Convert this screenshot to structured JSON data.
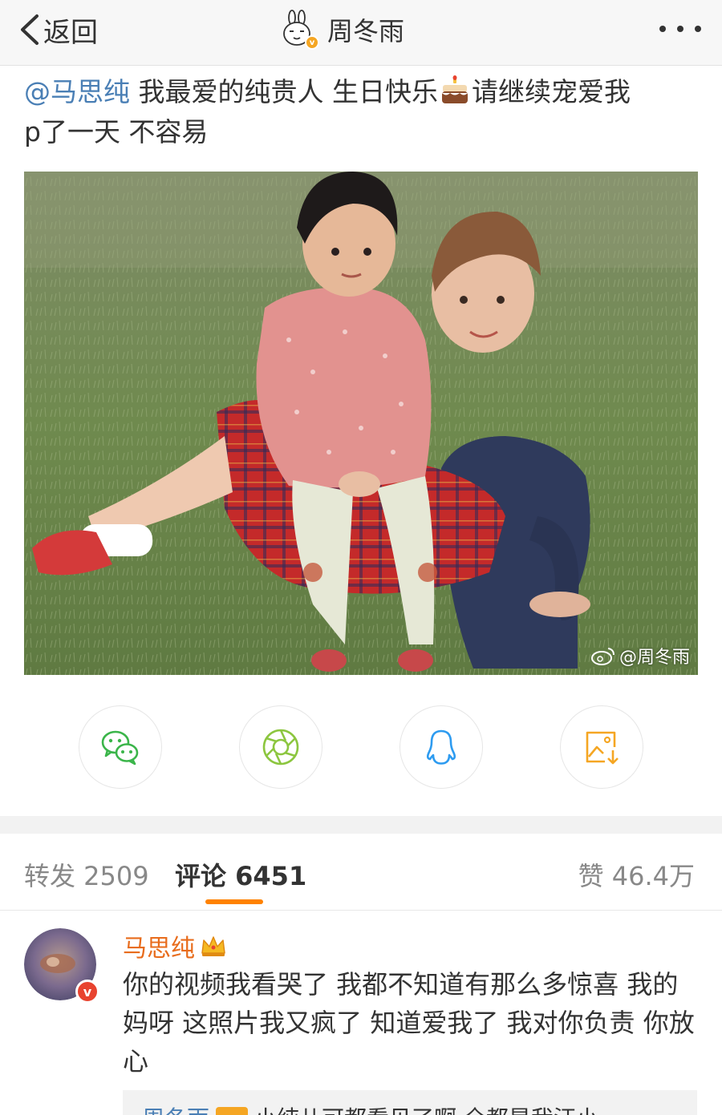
{
  "nav": {
    "back_label": "返回",
    "title": "周冬雨",
    "verified_badge": "v"
  },
  "post": {
    "mention": "@马思纯",
    "text_part1": " 我最爱的纯贵人 生日快乐",
    "text_part2": "请继续宠爱我",
    "text_line2": "p了一天 不容易",
    "emoji": "cake-icon",
    "watermark": "@周冬雨"
  },
  "share": {
    "icons": [
      "wechat-icon",
      "moments-icon",
      "qq-icon",
      "save-image-icon"
    ]
  },
  "tabs": {
    "repost": "转发 2509",
    "comment": "评论 6451",
    "like": "赞 46.4万"
  },
  "comment": {
    "author": "马思纯",
    "verified_badge": "v",
    "text": "你的视频我看哭了 我都不知道有那么多惊喜 我的妈呀 这照片我又疯了 知道爱我了 我对你负责 你放心"
  },
  "reply_preview": {
    "author": "周冬雨",
    "text": "小纯儿可都看见了啊 全都是我汪小"
  },
  "colors": {
    "accent_orange": "#ff8200",
    "mention_blue": "#4a7fb5",
    "author_orange": "#e86c1c",
    "wechat_green": "#3bb54a",
    "moments_green": "#8cc63f",
    "qq_blue": "#2d9bf0",
    "save_orange": "#f5a623"
  }
}
